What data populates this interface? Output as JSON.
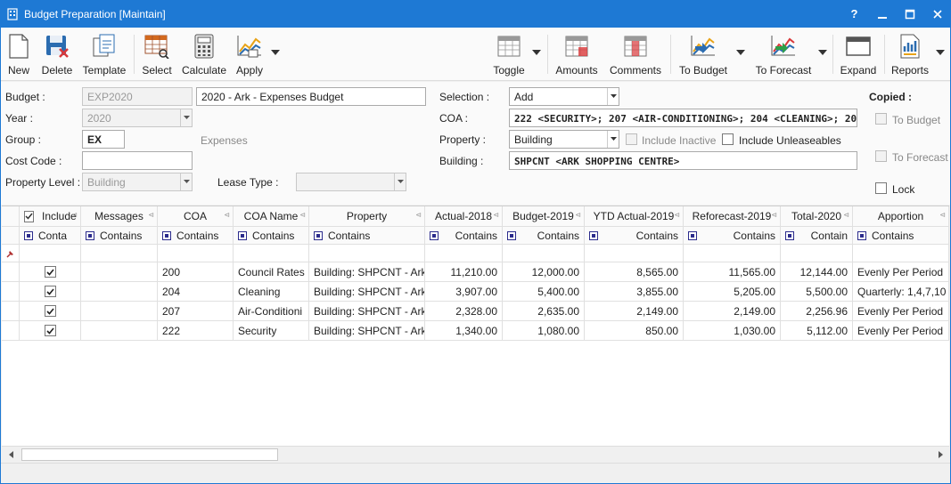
{
  "window": {
    "title": "Budget Preparation [Maintain]",
    "help": "?",
    "minimize": "—",
    "maximize": "□",
    "close": "✕"
  },
  "toolbar": {
    "new": "New",
    "delete": "Delete",
    "template": "Template",
    "select": "Select",
    "calculate": "Calculate",
    "apply": "Apply",
    "toggle": "Toggle",
    "amounts": "Amounts",
    "comments": "Comments",
    "to_budget": "To Budget",
    "to_forecast": "To Forecast",
    "expand": "Expand",
    "reports": "Reports"
  },
  "form": {
    "budget_label": "Budget :",
    "budget_code": "EXP2020",
    "budget_name": "2020 - Ark - Expenses Budget",
    "year_label": "Year :",
    "year_value": "2020",
    "group_label": "Group :",
    "group_value": "EX",
    "group_desc": "Expenses",
    "cost_code_label": "Cost Code :",
    "cost_code_value": "",
    "property_level_label": "Property Level :",
    "property_level_value": "Building",
    "lease_type_label": "Lease Type :",
    "lease_type_value": "",
    "selection_label": "Selection :",
    "selection_value": "Add",
    "coa_label": "COA :",
    "coa_value": "222 <SECURITY>; 207 <AIR-CONDITIONING>; 204 <CLEANING>; 200 <C",
    "property_label": "Property :",
    "property_value": "Building",
    "include_inactive": "Include Inactive",
    "include_unleaseables": "Include Unleaseables",
    "building_label": "Building :",
    "building_value": "SHPCNT <ARK SHOPPING CENTRE>",
    "copied_label": "Copied :",
    "copied_to_budget": "To Budget",
    "copied_to_forecast": "To Forecast",
    "lock": "Lock"
  },
  "grid": {
    "columns": [
      "Include",
      "Messages",
      "COA",
      "COA Name",
      "Property",
      "Actual-2018",
      "Budget-2019",
      "YTD Actual-2019",
      "Reforecast-2019",
      "Total-2020",
      "Apportion"
    ],
    "filters": [
      "Conta",
      "Contains",
      "Contains",
      "Contains",
      "Contains",
      "Contains",
      "Contains",
      "Contains",
      "Contains",
      "Contain",
      "Contains"
    ],
    "rows": [
      {
        "coa": "200",
        "name": "Council Rates",
        "property": "Building: SHPCNT - Ark",
        "actual": "11,210.00",
        "budget": "12,000.00",
        "ytd": "8,565.00",
        "reforecast": "11,565.00",
        "total": "12,144.00",
        "apportion": "Evenly Per Period"
      },
      {
        "coa": "204",
        "name": "Cleaning",
        "property": "Building: SHPCNT - Ark",
        "actual": "3,907.00",
        "budget": "5,400.00",
        "ytd": "3,855.00",
        "reforecast": "5,205.00",
        "total": "5,500.00",
        "apportion": "Quarterly: 1,4,7,10"
      },
      {
        "coa": "207",
        "name": "Air-Conditioni",
        "property": "Building: SHPCNT - Ark",
        "actual": "2,328.00",
        "budget": "2,635.00",
        "ytd": "2,149.00",
        "reforecast": "2,149.00",
        "total": "2,256.96",
        "apportion": "Evenly Per Period"
      },
      {
        "coa": "222",
        "name": "Security",
        "property": "Building: SHPCNT - Ark",
        "actual": "1,340.00",
        "budget": "1,080.00",
        "ytd": "850.00",
        "reforecast": "1,030.00",
        "total": "5,112.00",
        "apportion": "Evenly Per Period"
      }
    ]
  },
  "colors": {
    "titlebar": "#1e79d4",
    "accent_icon": "#2b6cb0",
    "filter_icon": "#2b2b8c"
  }
}
